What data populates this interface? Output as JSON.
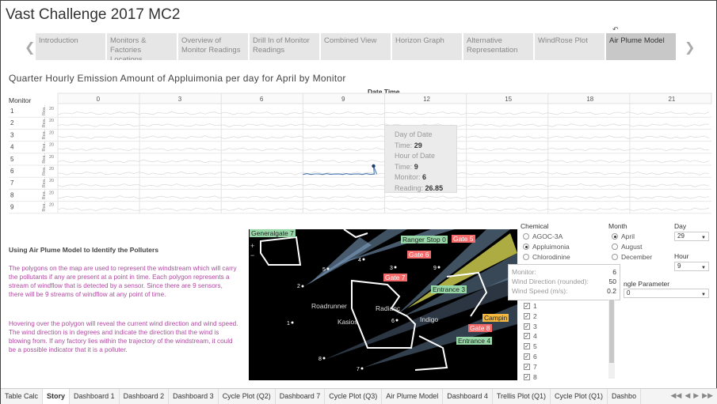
{
  "app": {
    "title": "Vast Challenge 2017 MC2"
  },
  "story_nav": {
    "refresh_glyph": "↶",
    "tabs": [
      {
        "label": "Introduction"
      },
      {
        "label": "Monitors & Factories Locations"
      },
      {
        "label": "Overview of Monitor Readings"
      },
      {
        "label": "Drill In of Monitor Readings"
      },
      {
        "label": "Combined View"
      },
      {
        "label": "Horizon Graph"
      },
      {
        "label": "Alternative Representation"
      },
      {
        "label": "WindRose Plot"
      },
      {
        "label": "Air Plume Model",
        "active": true
      }
    ]
  },
  "chart": {
    "title": "Quarter Hourly Emission Amount of Appluimonia per day for April by Monitor",
    "column_axis_title": "Date Time",
    "row_header": "Monitor",
    "hour_ticks": [
      "0",
      "3",
      "6",
      "9",
      "12",
      "15",
      "18",
      "21"
    ],
    "monitors": [
      "1",
      "2",
      "3",
      "4",
      "5",
      "6",
      "7",
      "8",
      "9"
    ],
    "row_axis_label": "Rea..",
    "row_axis_tick": "20"
  },
  "chart_data": {
    "type": "line",
    "title": "Quarter Hourly Emission Amount of Appluimonia per day for April by Monitor",
    "xlabel": "Date Time",
    "ylabel": "Rea..",
    "x_ticks": [
      "0",
      "3",
      "6",
      "9",
      "12",
      "15",
      "18",
      "21"
    ],
    "rows": [
      "1",
      "2",
      "3",
      "4",
      "5",
      "6",
      "7",
      "8",
      "9"
    ],
    "highlight": {
      "monitor": "6",
      "hour": 9,
      "day": 29,
      "reading": 26.85
    }
  },
  "chart_tooltip": {
    "day_of_date_label": "Day of Date",
    "time_label": "Time:",
    "day_value": "29",
    "hour_of_date_label": "Hour of Date",
    "hour_value": "9",
    "monitor_label": "Monitor:",
    "monitor_value": "6",
    "reading_label": "Reading:",
    "reading_value": "26.85"
  },
  "description": {
    "heading": "Using Air Plume Model to Identify the Polluters",
    "p1": "The polygons on the map are used to represent the windstream which will carry the pollutants if any are present at a point in time. Each polygon represents a stream of windflow that is detected by a sensor. Since there are 9 sensors, there will be 9 streams of windflow at any point of time.",
    "p2": "Hovering over the polygon will reveal the current wind direction and wind speed. The wind direction is in degrees and indicate the direction that the wind is blowing from. If any factory lies within the trajectory of the windstream, it could be a possible indicator that it is a polluter."
  },
  "map": {
    "labels": {
      "general_gate": "Generalgate 7",
      "ranger_stop": "Ranger Stop 0",
      "gate5": "Gate 5",
      "gate6": "Gate 6",
      "gate7": "Gate 7",
      "entrance3": "Entrance 3",
      "gate8": "Gate 8",
      "camping": "Campin",
      "entrance4": "Entrance 4",
      "roadrunner": "Roadrunner",
      "radiance": "Radianc",
      "kasios": "Kasios",
      "indigo": "Indigo"
    },
    "monitor_markers": [
      "1",
      "2",
      "3",
      "4",
      "5",
      "6",
      "7",
      "8",
      "9"
    ],
    "zoom_in": "+",
    "zoom_out": "−"
  },
  "map_tooltip": {
    "monitor_label": "Monitor:",
    "monitor_value": "6",
    "wind_dir_label": "Wind Direction (rounded):",
    "wind_dir_value": "50",
    "wind_speed_label": "Wind Speed (m/s):",
    "wind_speed_value": "0.2"
  },
  "filters": {
    "chemical_label": "Chemical",
    "chemicals": [
      {
        "label": "AGOC-3A",
        "selected": false
      },
      {
        "label": "Appluimonia",
        "selected": true
      },
      {
        "label": "Chlorodinine",
        "selected": false
      }
    ],
    "month_label": "Month",
    "months": [
      {
        "label": "April",
        "selected": true
      },
      {
        "label": "August",
        "selected": false
      },
      {
        "label": "December",
        "selected": false
      }
    ],
    "day_label": "Day",
    "day_value": "29",
    "hour_label": "Hour",
    "hour_value": "9",
    "angle_label": "ngle Parameter",
    "angle_value": "0",
    "monitor_checks": [
      "1",
      "2",
      "3",
      "4",
      "5",
      "6",
      "7",
      "8"
    ]
  },
  "bottom_tabs": [
    {
      "label": "Table Calc"
    },
    {
      "label": "Story",
      "active": true
    },
    {
      "label": "Dashboard 1"
    },
    {
      "label": "Dashboard 2"
    },
    {
      "label": "Dashboard 3"
    },
    {
      "label": "Cycle Plot (Q2)"
    },
    {
      "label": "Dashboard 7"
    },
    {
      "label": "Cycle Plot (Q3)"
    },
    {
      "label": "Air Plume Model"
    },
    {
      "label": "Dashboard 4"
    },
    {
      "label": "Trellis Plot (Q1)"
    },
    {
      "label": "Cycle Plot (Q1)"
    },
    {
      "label": "Dashbo"
    }
  ],
  "colors": {
    "plume_blue": "#8fb4d9",
    "plume_yellow": "#e6e65a",
    "boundary": "#ffffff",
    "desc_text": "#b04aa0",
    "line": "#4a78b0"
  }
}
